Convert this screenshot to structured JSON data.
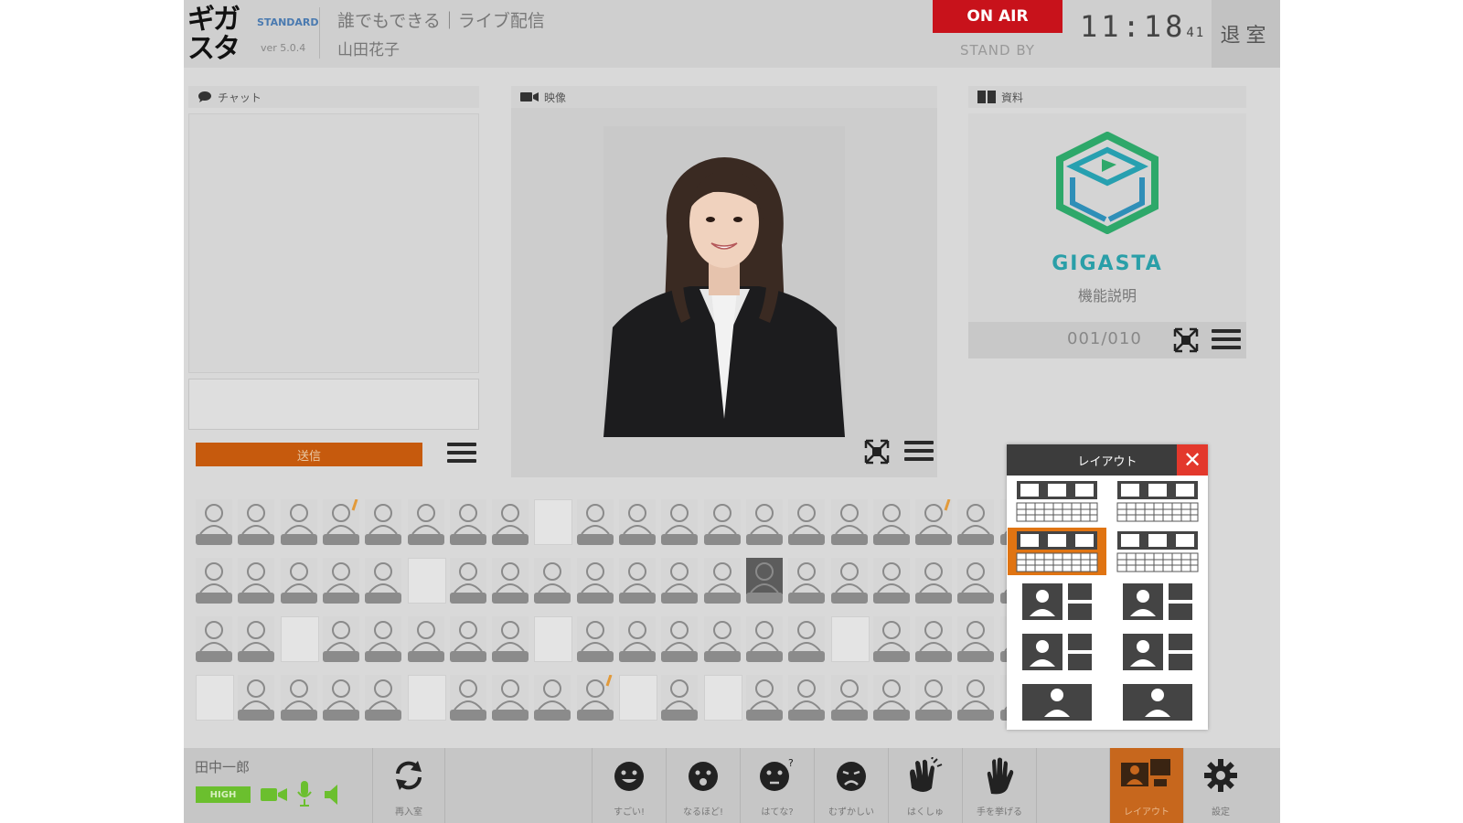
{
  "header": {
    "logo": "ギガ\nスタ",
    "edition": "STANDARD",
    "version": "ver 5.0.4",
    "title": "誰でもできる｜ライブ配信",
    "presenter": "山田花子",
    "on_air": "ON AIR",
    "stand_by": "STAND BY",
    "clock": "11:18",
    "clock_seconds": "41",
    "exit_label": "退室"
  },
  "chat": {
    "title": "チャット",
    "send_label": "送信"
  },
  "video": {
    "title": "映像"
  },
  "document": {
    "title": "資料",
    "brand": "GIGASTA",
    "caption": "機能説明",
    "page": "001/010"
  },
  "bottom": {
    "username": "田中一郎",
    "quality": "HIGH",
    "rejoin_label": "再入室",
    "reactions": [
      "すごい!",
      "なるほど!",
      "はてな?",
      "むずかしい",
      "はくしゅ",
      "手を挙げる"
    ],
    "layout_label": "レイアウト",
    "settings_label": "設定"
  },
  "layout_popup": {
    "title": "レイアウト",
    "close": "✕",
    "selected_index": 2
  },
  "icons": [
    "chat-bubble-icon",
    "video-camera-icon",
    "document-icon",
    "expand-icon",
    "menu-icon",
    "refresh-icon",
    "camera-icon",
    "mic-icon",
    "speaker-icon",
    "smile-icon",
    "surprise-icon",
    "question-icon",
    "sad-icon",
    "clap-icon",
    "hand-icon",
    "layout-icon",
    "gear-icon",
    "close-icon"
  ],
  "colors": {
    "on_air": "#c8121b",
    "send": "#c65a0d",
    "quality": "#6bbf2e",
    "layout_active": "#e07412",
    "close": "#e3382c",
    "brand": "#2a9fa8"
  }
}
